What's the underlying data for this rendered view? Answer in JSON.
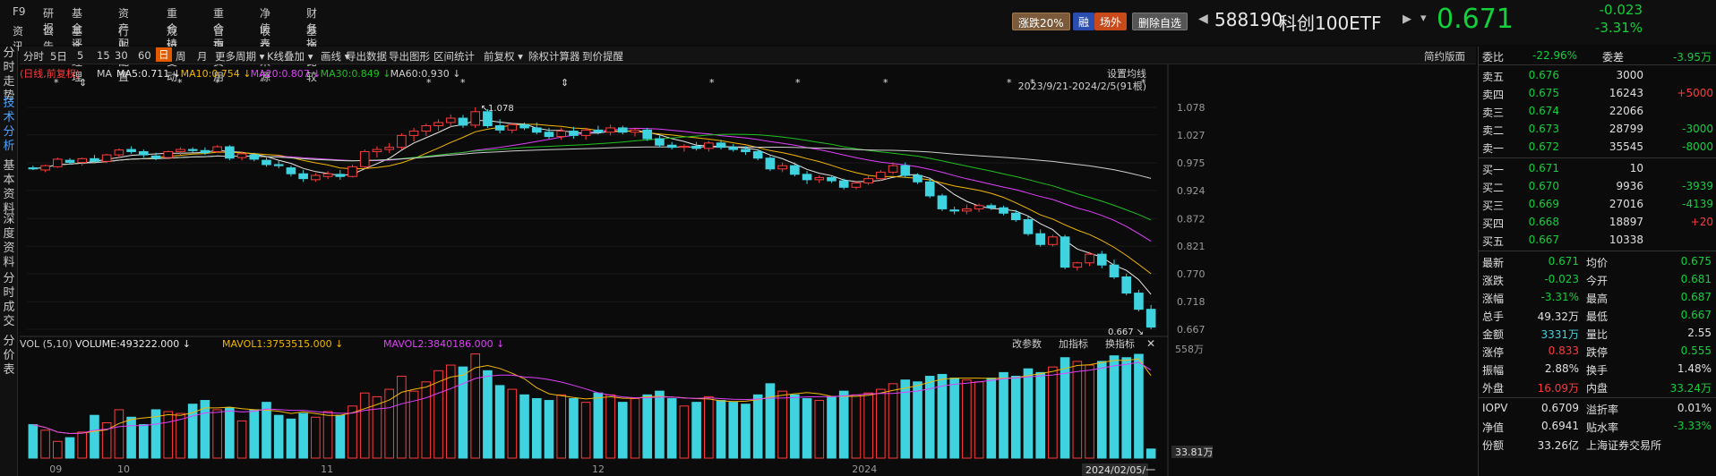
{
  "menu": {
    "row1": [
      "F9",
      "研报",
      "基金评级",
      "资产配置",
      "重合持股",
      "重合贡献",
      "净值表现",
      "财务指标"
    ],
    "row2": [
      "资讯",
      "公告",
      "基金经理",
      "行业配置",
      "规模变动",
      "管理费用",
      "收益来源",
      "基金比较"
    ]
  },
  "header": {
    "limit_badge": "涨跌20%",
    "margin_badge": "融",
    "offexchange_badge": "场外",
    "remove_fav": "删除自选",
    "symbol": "588190",
    "name": "科创100ETF",
    "price": "0.671",
    "change": "-0.023",
    "change_pct": "-3.31%"
  },
  "sidebar": [
    "分时走势",
    "技术分析",
    "基本资料",
    "深度资料",
    "分时成交",
    "分价表"
  ],
  "toolbar": [
    "分时",
    "5日",
    "5",
    "15",
    "30",
    "60",
    "日",
    "周",
    "月",
    "更多周期",
    "K线叠加",
    "画线",
    "导出数据",
    "导出图形",
    "区间统计",
    "前复权",
    "除权计算器",
    "到价提醒",
    "简约版面"
  ],
  "chart": {
    "adjust_label": "(日线,前复权)",
    "ma": [
      {
        "label": "MA",
        "value": "",
        "color": "#cfcfcf"
      },
      {
        "label": "MA5:0.711",
        "color": "#e8e8e8"
      },
      {
        "label": "MA10:0.754",
        "color": "#f2b705"
      },
      {
        "label": "MA20:0.807",
        "color": "#e040fb"
      },
      {
        "label": "MA30:0.849",
        "color": "#20c020"
      },
      {
        "label": "MA60:0.930",
        "color": "#cfcfcf"
      }
    ],
    "settings": "设置均线",
    "range": "2023/9/21-2024/2/5(91根)",
    "price_ticks": [
      "1.078",
      "1.027",
      "0.975",
      "0.924",
      "0.872",
      "0.821",
      "0.770",
      "0.718",
      "0.667"
    ],
    "high_label": "1.078",
    "low_label": "0.667",
    "vol_header": "VOL (5,10)",
    "vol_value": "VOLUME:493222.000",
    "mavol1": "MAVOL1:3753515.000",
    "mavol2": "MAVOL2:3840186.000",
    "vol_buttons": [
      "改参数",
      "加指标",
      "换指标"
    ],
    "vol_ticks": [
      "558万",
      "33.81万"
    ],
    "x_labels": [
      "09",
      "10",
      "11",
      "12",
      "2024"
    ],
    "cursor_date": "2024/02/05/一"
  },
  "chart_data": {
    "type": "candlestick",
    "ylim": [
      0.667,
      1.078
    ],
    "candles": [
      [
        0.966,
        0.97,
        0.962,
        0.964
      ],
      [
        0.962,
        0.972,
        0.958,
        0.97
      ],
      [
        0.968,
        0.985,
        0.966,
        0.982
      ],
      [
        0.98,
        0.984,
        0.972,
        0.976
      ],
      [
        0.976,
        0.985,
        0.97,
        0.983
      ],
      [
        0.983,
        0.99,
        0.975,
        0.978
      ],
      [
        0.978,
        0.992,
        0.975,
        0.99
      ],
      [
        0.99,
        1.002,
        0.985,
        0.999
      ],
      [
        1.0,
        1.006,
        0.992,
        0.996
      ],
      [
        0.996,
        1.0,
        0.985,
        0.99
      ],
      [
        0.988,
        0.994,
        0.98,
        0.984
      ],
      [
        0.985,
        0.998,
        0.982,
        0.996
      ],
      [
        0.996,
        1.004,
        0.99,
        1.0
      ],
      [
        1.0,
        1.004,
        0.994,
        0.998
      ],
      [
        0.998,
        1.004,
        0.99,
        0.994
      ],
      [
        0.996,
        1.008,
        0.994,
        1.005
      ],
      [
        1.005,
        1.008,
        0.98,
        0.984
      ],
      [
        0.985,
        0.996,
        0.98,
        0.992
      ],
      [
        0.99,
        0.994,
        0.978,
        0.982
      ],
      [
        0.98,
        0.985,
        0.968,
        0.972
      ],
      [
        0.972,
        0.98,
        0.965,
        0.97
      ],
      [
        0.966,
        0.97,
        0.95,
        0.955
      ],
      [
        0.955,
        0.962,
        0.94,
        0.946
      ],
      [
        0.944,
        0.956,
        0.94,
        0.952
      ],
      [
        0.95,
        0.96,
        0.945,
        0.955
      ],
      [
        0.954,
        0.962,
        0.944,
        0.95
      ],
      [
        0.95,
        0.972,
        0.948,
        0.968
      ],
      [
        0.968,
        1.0,
        0.965,
        0.996
      ],
      [
        0.996,
        1.006,
        0.985,
        1.0
      ],
      [
        1.0,
        1.012,
        0.994,
        1.004
      ],
      [
        1.004,
        1.03,
        1.0,
        1.026
      ],
      [
        1.026,
        1.04,
        1.015,
        1.034
      ],
      [
        1.034,
        1.048,
        1.025,
        1.044
      ],
      [
        1.044,
        1.056,
        1.035,
        1.05
      ],
      [
        1.05,
        1.065,
        1.042,
        1.058
      ],
      [
        1.058,
        1.064,
        1.04,
        1.045
      ],
      [
        1.045,
        1.078,
        1.04,
        1.07
      ],
      [
        1.07,
        1.075,
        1.04,
        1.044
      ],
      [
        1.044,
        1.056,
        1.03,
        1.036
      ],
      [
        1.036,
        1.05,
        1.03,
        1.046
      ],
      [
        1.046,
        1.05,
        1.036,
        1.04
      ],
      [
        1.04,
        1.05,
        1.028,
        1.032
      ],
      [
        1.032,
        1.04,
        1.02,
        1.024
      ],
      [
        1.024,
        1.04,
        1.018,
        1.034
      ],
      [
        1.034,
        1.042,
        1.02,
        1.026
      ],
      [
        1.026,
        1.04,
        1.018,
        1.036
      ],
      [
        1.036,
        1.044,
        1.028,
        1.032
      ],
      [
        1.032,
        1.046,
        1.026,
        1.04
      ],
      [
        1.04,
        1.044,
        1.028,
        1.032
      ],
      [
        1.032,
        1.04,
        1.024,
        1.036
      ],
      [
        1.036,
        1.04,
        1.016,
        1.02
      ],
      [
        1.02,
        1.026,
        1.004,
        1.008
      ],
      [
        1.008,
        1.014,
        1.0,
        1.004
      ],
      [
        1.004,
        1.01,
        0.996,
        1.006
      ],
      [
        1.006,
        1.014,
        0.998,
        1.002
      ],
      [
        1.002,
        1.016,
        0.996,
        1.012
      ],
      [
        1.012,
        1.018,
        1.0,
        1.004
      ],
      [
        1.004,
        1.01,
        0.996,
        1.0
      ],
      [
        1.0,
        1.006,
        0.99,
        0.996
      ],
      [
        0.996,
        1.0,
        0.98,
        0.984
      ],
      [
        0.984,
        0.988,
        0.96,
        0.964
      ],
      [
        0.964,
        0.976,
        0.958,
        0.97
      ],
      [
        0.97,
        0.976,
        0.95,
        0.954
      ],
      [
        0.954,
        0.96,
        0.936,
        0.944
      ],
      [
        0.944,
        0.952,
        0.938,
        0.948
      ],
      [
        0.948,
        0.95,
        0.938,
        0.942
      ],
      [
        0.942,
        0.946,
        0.926,
        0.93
      ],
      [
        0.93,
        0.942,
        0.926,
        0.938
      ],
      [
        0.938,
        0.952,
        0.934,
        0.946
      ],
      [
        0.946,
        0.962,
        0.942,
        0.958
      ],
      [
        0.958,
        0.976,
        0.954,
        0.97
      ],
      [
        0.97,
        0.976,
        0.948,
        0.952
      ],
      [
        0.952,
        0.956,
        0.936,
        0.94
      ],
      [
        0.94,
        0.946,
        0.91,
        0.914
      ],
      [
        0.914,
        0.918,
        0.886,
        0.89
      ],
      [
        0.888,
        0.894,
        0.88,
        0.886
      ],
      [
        0.886,
        0.898,
        0.88,
        0.89
      ],
      [
        0.89,
        0.9,
        0.884,
        0.896
      ],
      [
        0.896,
        0.9,
        0.888,
        0.892
      ],
      [
        0.892,
        0.896,
        0.878,
        0.882
      ],
      [
        0.882,
        0.888,
        0.866,
        0.87
      ],
      [
        0.87,
        0.876,
        0.84,
        0.844
      ],
      [
        0.844,
        0.852,
        0.82,
        0.824
      ],
      [
        0.824,
        0.842,
        0.82,
        0.838
      ],
      [
        0.838,
        0.842,
        0.778,
        0.782
      ],
      [
        0.782,
        0.792,
        0.776,
        0.79
      ],
      [
        0.79,
        0.81,
        0.784,
        0.806
      ],
      [
        0.806,
        0.812,
        0.78,
        0.786
      ],
      [
        0.786,
        0.796,
        0.76,
        0.764
      ],
      [
        0.764,
        0.77,
        0.73,
        0.734
      ],
      [
        0.734,
        0.74,
        0.7,
        0.704
      ],
      [
        0.704,
        0.712,
        0.667,
        0.671
      ]
    ],
    "volumes": [
      1.8,
      1.5,
      0.9,
      1.1,
      1.4,
      2.3,
      1.9,
      2.6,
      2.2,
      1.8,
      2.6,
      2.5,
      2.4,
      2.9,
      3.1,
      2.6,
      2.7,
      2.0,
      2.6,
      3.0,
      2.3,
      2.1,
      2.4,
      2.2,
      2.5,
      2.3,
      2.8,
      3.5,
      3.3,
      3.7,
      4.4,
      3.6,
      4.1,
      4.7,
      5.0,
      4.9,
      5.6,
      4.7,
      3.9,
      3.7,
      3.4,
      3.2,
      3.1,
      3.4,
      3.2,
      3.0,
      3.5,
      3.4,
      3.0,
      3.2,
      3.4,
      3.6,
      3.2,
      2.8,
      3.0,
      3.3,
      3.1,
      3.0,
      2.9,
      3.4,
      4.0,
      3.6,
      3.4,
      3.2,
      3.1,
      3.3,
      3.6,
      3.4,
      3.5,
      3.7,
      4.0,
      4.2,
      4.1,
      4.4,
      4.5,
      4.3,
      4.2,
      4.1,
      4.3,
      4.6,
      4.4,
      4.8,
      4.6,
      4.9,
      5.4,
      5.2,
      5.0,
      5.2,
      5.5,
      5.4,
      5.58,
      0.49
    ]
  },
  "quote": {
    "webi": "委比",
    "webi_val": "-22.96%",
    "wecha": "委差",
    "wecha_val": "-3.95万",
    "asks": [
      [
        "卖五",
        "0.676",
        "3000",
        ""
      ],
      [
        "卖四",
        "0.675",
        "16243",
        "+5000"
      ],
      [
        "卖三",
        "0.674",
        "22066",
        ""
      ],
      [
        "卖二",
        "0.673",
        "28799",
        "-3000"
      ],
      [
        "卖一",
        "0.672",
        "35545",
        "-8000"
      ]
    ],
    "bids": [
      [
        "买一",
        "0.671",
        "10",
        ""
      ],
      [
        "买二",
        "0.670",
        "9936",
        "-3939"
      ],
      [
        "买三",
        "0.669",
        "27016",
        "-4139"
      ],
      [
        "买四",
        "0.668",
        "18897",
        "+20"
      ],
      [
        "买五",
        "0.667",
        "10338",
        ""
      ]
    ],
    "stats": [
      [
        "最新",
        "0.671",
        "均价",
        "0.675"
      ],
      [
        "涨跌",
        "-0.023",
        "今开",
        "0.681"
      ],
      [
        "涨幅",
        "-3.31%",
        "最高",
        "0.687"
      ],
      [
        "总手",
        "49.32万",
        "最低",
        "0.667"
      ],
      [
        "金额",
        "3331万",
        "量比",
        "2.55"
      ],
      [
        "涨停",
        "0.833",
        "跌停",
        "0.555"
      ],
      [
        "振幅",
        "2.88%",
        "换手",
        "1.48%"
      ],
      [
        "外盘",
        "16.09万",
        "内盘",
        "33.24万"
      ]
    ],
    "extra": [
      [
        "IOPV",
        "0.6709",
        "溢折率",
        "0.01%"
      ],
      [
        "净值",
        "0.6941",
        "贴水率",
        "-3.33%"
      ],
      [
        "份额",
        "33.26亿",
        "上海证券交易所",
        ""
      ]
    ]
  }
}
